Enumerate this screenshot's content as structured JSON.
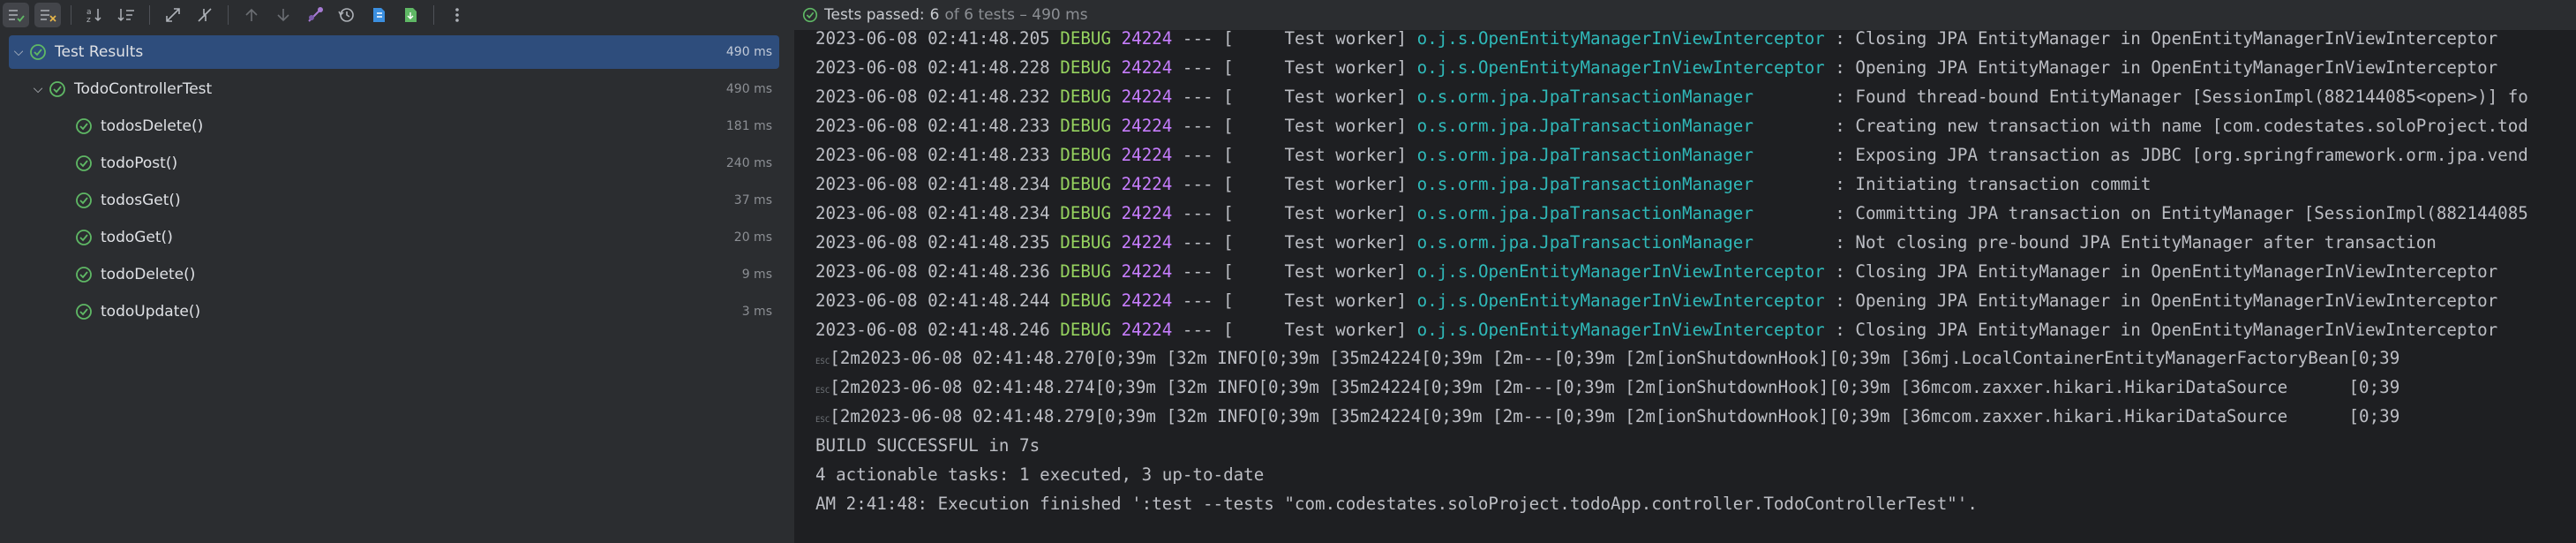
{
  "status": {
    "label": "Tests passed:",
    "count": "6",
    "detail": "of 6 tests – 490 ms"
  },
  "tree": [
    {
      "name": "Test Results",
      "ms": "490 ms"
    },
    {
      "name": "TodoControllerTest",
      "ms": "490 ms"
    },
    {
      "name": "todosDelete()",
      "ms": "181 ms"
    },
    {
      "name": "todoPost()",
      "ms": "240 ms"
    },
    {
      "name": "todosGet()",
      "ms": "37 ms"
    },
    {
      "name": "todoGet()",
      "ms": "20 ms"
    },
    {
      "name": "todoDelete()",
      "ms": "9 ms"
    },
    {
      "name": "todoUpdate()",
      "ms": "3 ms"
    }
  ],
  "log": [
    {
      "ts": "2023-06-08 02:41:48.205",
      "level": "DEBUG",
      "pid": "24224",
      "sep": "--- [",
      "thread": "    Test worker]",
      "logger": "o.j.s.OpenEntityManagerInViewInterceptor",
      "msg": ": Closing JPA EntityManager in OpenEntityManagerInViewInterceptor"
    },
    {
      "ts": "2023-06-08 02:41:48.228",
      "level": "DEBUG",
      "pid": "24224",
      "sep": "--- [",
      "thread": "    Test worker]",
      "logger": "o.j.s.OpenEntityManagerInViewInterceptor",
      "msg": ": Opening JPA EntityManager in OpenEntityManagerInViewInterceptor"
    },
    {
      "ts": "2023-06-08 02:41:48.232",
      "level": "DEBUG",
      "pid": "24224",
      "sep": "--- [",
      "thread": "    Test worker]",
      "logger": "o.s.orm.jpa.JpaTransactionManager       ",
      "msg": ": Found thread-bound EntityManager [SessionImpl(882144085<open>)] fo"
    },
    {
      "ts": "2023-06-08 02:41:48.233",
      "level": "DEBUG",
      "pid": "24224",
      "sep": "--- [",
      "thread": "    Test worker]",
      "logger": "o.s.orm.jpa.JpaTransactionManager       ",
      "msg": ": Creating new transaction with name [com.codestates.soloProject.tod"
    },
    {
      "ts": "2023-06-08 02:41:48.233",
      "level": "DEBUG",
      "pid": "24224",
      "sep": "--- [",
      "thread": "    Test worker]",
      "logger": "o.s.orm.jpa.JpaTransactionManager       ",
      "msg": ": Exposing JPA transaction as JDBC [org.springframework.orm.jpa.vend"
    },
    {
      "ts": "2023-06-08 02:41:48.234",
      "level": "DEBUG",
      "pid": "24224",
      "sep": "--- [",
      "thread": "    Test worker]",
      "logger": "o.s.orm.jpa.JpaTransactionManager       ",
      "msg": ": Initiating transaction commit"
    },
    {
      "ts": "2023-06-08 02:41:48.234",
      "level": "DEBUG",
      "pid": "24224",
      "sep": "--- [",
      "thread": "    Test worker]",
      "logger": "o.s.orm.jpa.JpaTransactionManager       ",
      "msg": ": Committing JPA transaction on EntityManager [SessionImpl(882144085"
    },
    {
      "ts": "2023-06-08 02:41:48.235",
      "level": "DEBUG",
      "pid": "24224",
      "sep": "--- [",
      "thread": "    Test worker]",
      "logger": "o.s.orm.jpa.JpaTransactionManager       ",
      "msg": ": Not closing pre-bound JPA EntityManager after transaction"
    },
    {
      "ts": "2023-06-08 02:41:48.236",
      "level": "DEBUG",
      "pid": "24224",
      "sep": "--- [",
      "thread": "    Test worker]",
      "logger": "o.j.s.OpenEntityManagerInViewInterceptor",
      "msg": ": Closing JPA EntityManager in OpenEntityManagerInViewInterceptor"
    },
    {
      "ts": "2023-06-08 02:41:48.244",
      "level": "DEBUG",
      "pid": "24224",
      "sep": "--- [",
      "thread": "    Test worker]",
      "logger": "o.j.s.OpenEntityManagerInViewInterceptor",
      "msg": ": Opening JPA EntityManager in OpenEntityManagerInViewInterceptor"
    },
    {
      "ts": "2023-06-08 02:41:48.246",
      "level": "DEBUG",
      "pid": "24224",
      "sep": "--- [",
      "thread": "    Test worker]",
      "logger": "o.j.s.OpenEntityManagerInViewInterceptor",
      "msg": ": Closing JPA EntityManager in OpenEntityManagerInViewInterceptor"
    }
  ],
  "raw": [
    "[2m2023-06-08 02:41:48.270[0;39m [32m INFO[0;39m [35m24224[0;39m [2m---[0;39m [2m[ionShutdownHook][0;39m [36mj.LocalContainerEntityManagerFactoryBean[0;39",
    "[2m2023-06-08 02:41:48.274[0;39m [32m INFO[0;39m [35m24224[0;39m [2m---[0;39m [2m[ionShutdownHook][0;39m [36mcom.zaxxer.hikari.HikariDataSource      [0;39",
    "[2m2023-06-08 02:41:48.279[0;39m [32m INFO[0;39m [35m24224[0;39m [2m---[0;39m [2m[ionShutdownHook][0;39m [36mcom.zaxxer.hikari.HikariDataSource      [0;39"
  ],
  "tail": [
    "BUILD SUCCESSFUL in 7s",
    "4 actionable tasks: 1 executed, 3 up-to-date",
    "AM 2:41:48: Execution finished ':test --tests \"com.codestates.soloProject.todoApp.controller.TodoControllerTest\"'."
  ],
  "esc_glyph": "ESC",
  "icons": [
    "show-passed-icon",
    "show-ignored-icon",
    "sort-alpha-icon",
    "sort-duration-icon",
    "expand-all-icon",
    "collapse-all-icon",
    "prev-failed-icon",
    "next-failed-icon",
    "export-icon",
    "history-icon",
    "import-icon",
    "export-file-icon",
    "more-icon"
  ],
  "colors": {
    "pass": "#5fb865",
    "debug": "#96d35f",
    "pid": "#c77dff",
    "logger": "#2fb9b9",
    "selected": "#2e4d7c"
  }
}
